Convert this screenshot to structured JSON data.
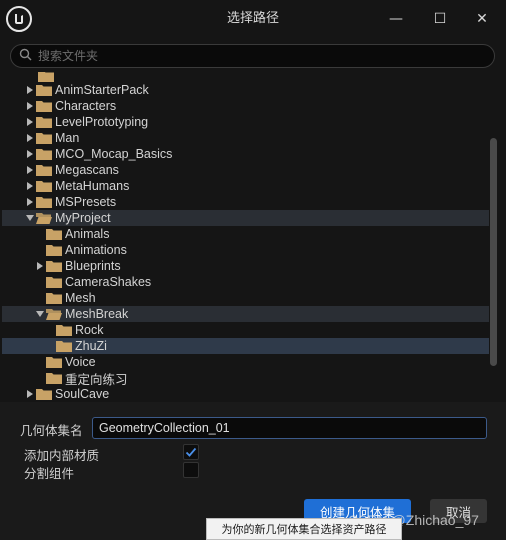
{
  "window": {
    "title": "选择路径",
    "minimize_glyph": "—",
    "maximize_glyph": "☐",
    "close_glyph": "✕"
  },
  "search": {
    "placeholder": "搜索文件夹",
    "icon": "search-icon"
  },
  "tree": {
    "items": [
      {
        "label": "AnimStarterPack",
        "depth": 0,
        "has_children": true,
        "expanded": false
      },
      {
        "label": "Characters",
        "depth": 0,
        "has_children": true,
        "expanded": false
      },
      {
        "label": "LevelPrototyping",
        "depth": 0,
        "has_children": true,
        "expanded": false
      },
      {
        "label": "Man",
        "depth": 0,
        "has_children": true,
        "expanded": false
      },
      {
        "label": "MCO_Mocap_Basics",
        "depth": 0,
        "has_children": true,
        "expanded": false
      },
      {
        "label": "Megascans",
        "depth": 0,
        "has_children": true,
        "expanded": false
      },
      {
        "label": "MetaHumans",
        "depth": 0,
        "has_children": true,
        "expanded": false
      },
      {
        "label": "MSPresets",
        "depth": 0,
        "has_children": true,
        "expanded": false
      },
      {
        "label": "MyProject",
        "depth": 0,
        "has_children": true,
        "expanded": true
      },
      {
        "label": "Animals",
        "depth": 1,
        "has_children": false,
        "expanded": false
      },
      {
        "label": "Animations",
        "depth": 1,
        "has_children": false,
        "expanded": false
      },
      {
        "label": "Blueprints",
        "depth": 1,
        "has_children": true,
        "expanded": false
      },
      {
        "label": "CameraShakes",
        "depth": 1,
        "has_children": false,
        "expanded": false
      },
      {
        "label": "Mesh",
        "depth": 1,
        "has_children": false,
        "expanded": false
      },
      {
        "label": "MeshBreak",
        "depth": 1,
        "has_children": true,
        "expanded": true
      },
      {
        "label": "Rock",
        "depth": 2,
        "has_children": false,
        "expanded": false
      },
      {
        "label": "ZhuZi",
        "depth": 2,
        "has_children": false,
        "expanded": false,
        "selected": true
      },
      {
        "label": "Voice",
        "depth": 1,
        "has_children": false,
        "expanded": false
      },
      {
        "label": "重定向练习",
        "depth": 1,
        "has_children": false,
        "expanded": false
      },
      {
        "label": "SoulCave",
        "depth": 0,
        "has_children": true,
        "expanded": false
      }
    ]
  },
  "form": {
    "name_label": "几何体集名",
    "name_value": "GeometryCollection_01",
    "add_internal_material_label": "添加内部材质",
    "add_internal_material_checked": true,
    "split_components_label": "分割组件",
    "split_components_checked": false
  },
  "buttons": {
    "create_label": "创建几何体集",
    "cancel_label": "取消"
  },
  "tooltip": {
    "text": "为你的新几何体集合选择资产路径"
  },
  "watermark": {
    "text": "CSDN @Zhichao_97"
  },
  "colors": {
    "folder": "#c8a266",
    "accent": "#1f6fd6",
    "checkmark": "#4a8fe8"
  }
}
